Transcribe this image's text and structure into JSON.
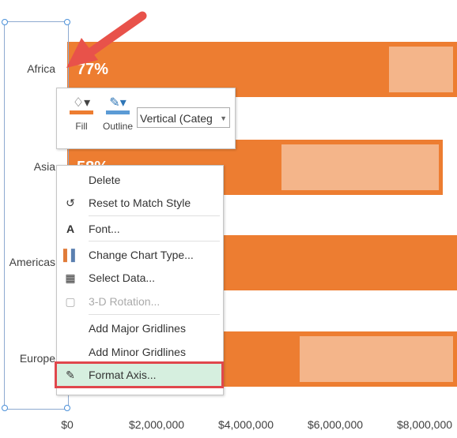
{
  "chart_data": {
    "type": "bar",
    "orientation": "horizontal",
    "categories": [
      "Africa",
      "Asia",
      "Americas",
      "Europe"
    ],
    "series": [
      {
        "values": [
          9500000,
          8400000,
          9500000,
          9500000
        ],
        "color": "#ED7D31"
      },
      {
        "values": [
          7200000,
          4800000,
          null,
          5200000
        ],
        "color": "#F4B58A"
      }
    ],
    "data_labels": [
      "77%",
      "58%",
      "",
      ""
    ],
    "x_ticks": [
      "$0",
      "$2,000,000",
      "$4,000,000",
      "$6,000,000",
      "$8,000,000"
    ],
    "x_tick_values": [
      0,
      2000000,
      4000000,
      6000000,
      8000000
    ],
    "xlim": [
      0,
      8700000
    ],
    "grid": false,
    "selected_axis": "vertical-category"
  },
  "mini_toolbar": {
    "fill_label": "Fill",
    "fill_color": "#ED7D31",
    "outline_label": "Outline",
    "outline_color": "#5B9BD5",
    "element_select": "Vertical (Categ"
  },
  "context_menu": {
    "items": [
      {
        "label": "Delete",
        "icon": ""
      },
      {
        "label": "Reset to Match Style",
        "icon": "reset-style-icon"
      },
      {
        "label": "Font...",
        "icon": "font-icon"
      },
      {
        "label": "Change Chart Type...",
        "icon": "chart-type-icon"
      },
      {
        "label": "Select Data...",
        "icon": "select-data-icon"
      },
      {
        "label": "3-D Rotation...",
        "icon": "3d-rotation-icon",
        "disabled": true
      },
      {
        "label": "Add Major Gridlines",
        "icon": ""
      },
      {
        "label": "Add Minor Gridlines",
        "icon": ""
      },
      {
        "label": "Format Axis...",
        "icon": "format-axis-icon",
        "highlighted": true
      }
    ]
  },
  "annotation": {
    "arrow_color": "#E8524A"
  }
}
